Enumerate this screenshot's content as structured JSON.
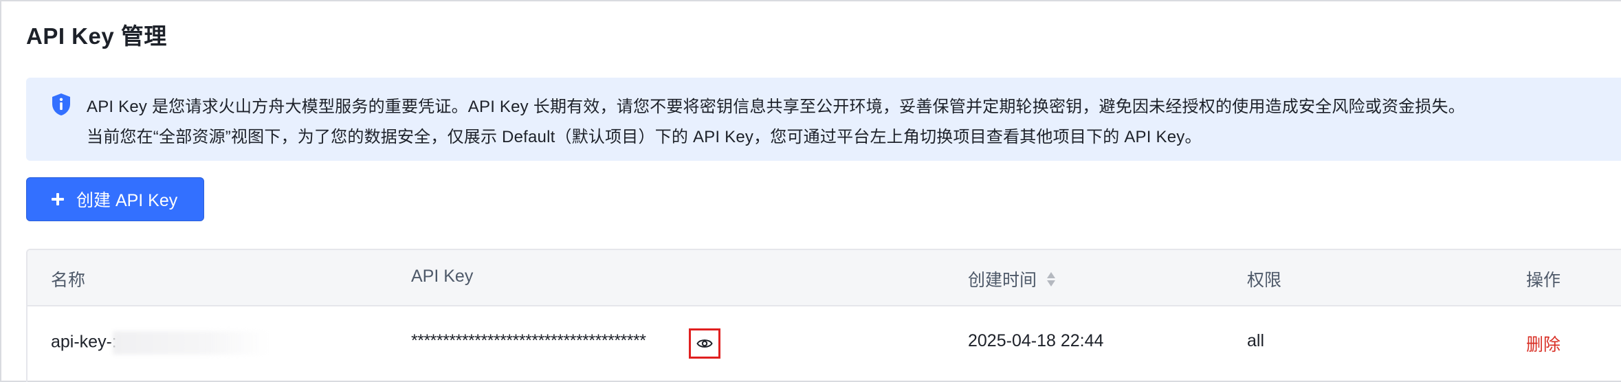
{
  "page": {
    "title": "API Key 管理"
  },
  "alert": {
    "icon": "info-shield-icon",
    "color": "#3370ff",
    "line1": "API Key 是您请求火山方舟大模型服务的重要凭证。API Key 长期有效，请您不要将密钥信息共享至公开环境，妥善保管并定期轮换密钥，避免因未经授权的使用造成安全风险或资金损失。",
    "line2": "当前您在“全部资源”视图下，为了您的数据安全，仅展示 Default（默认项目）下的 API Key，您可通过平台左上角切换项目查看其他项目下的 API Key。"
  },
  "create_button": {
    "label": "创建 API Key",
    "icon": "plus-icon",
    "color": "#3370ff"
  },
  "table": {
    "columns": [
      "名称",
      "API Key",
      "创建时间",
      "权限",
      "操作"
    ],
    "sort_icon": "sort-icon",
    "rows": [
      {
        "name": "api-key-:",
        "api_key": "*************************************",
        "view_icon": "eye-icon",
        "created_at": "2025-04-18 22:44",
        "permission": "all",
        "action": "删除"
      }
    ]
  },
  "colors": {
    "danger": "#d93026",
    "highlight_box": "#e02020"
  }
}
